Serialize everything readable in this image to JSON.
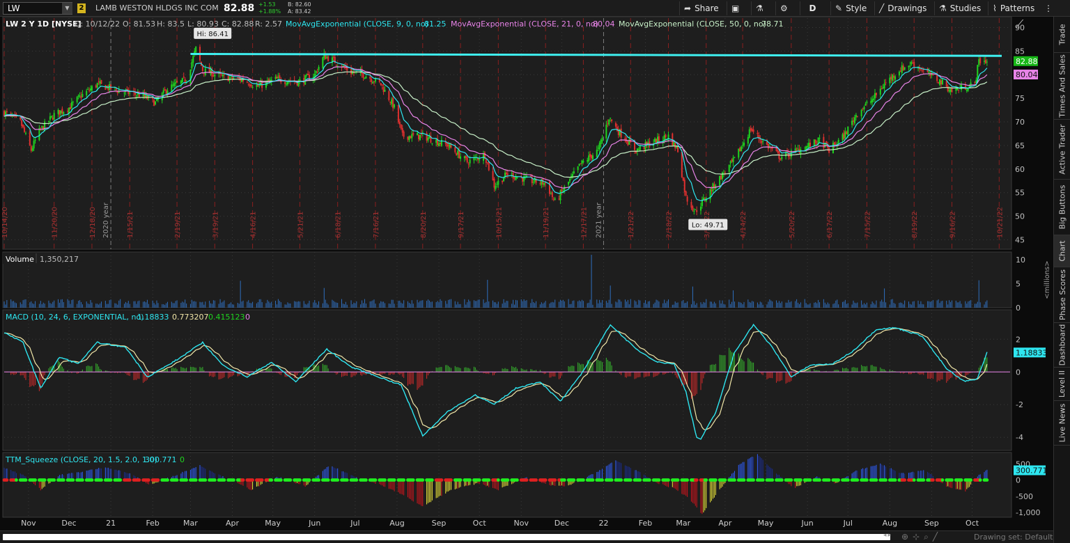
{
  "toolbar": {
    "symbol": "LW",
    "link_badge": "2",
    "company": "LAMB WESTON HLDGS INC COM",
    "last": "82.88",
    "change": "+1.53",
    "change_pct": "+1.88%",
    "bid": "B: 82.60",
    "ask": "A: 83.42",
    "share_label": "Share",
    "aggregation": "D",
    "style_label": "Style",
    "drawings_label": "Drawings",
    "studies_label": "Studies",
    "patterns_label": "Patterns"
  },
  "header": {
    "title": "LW 2 Y 1D [NYSE]",
    "date": "D: 10/12/22",
    "open": "O: 81.53",
    "high": "H: 83.5",
    "low": "L: 80.93",
    "close": "C: 82.88",
    "range": "R: 2.57",
    "ema9_label": "MovAvgExponential (CLOSE, 9, 0, no)",
    "ema9_value": "81.25",
    "ema21_label": "MovAvgExponential (CLOSE, 21, 0, no)",
    "ema21_value": "80.04",
    "ema50_label": "MovAvgExponential (CLOSE, 50, 0, no)",
    "ema50_value": "78.71"
  },
  "sidebar": {
    "tabs": [
      "Trade",
      "Times And Sales",
      "Active Trader",
      "Big Buttons",
      "Chart",
      "Phase Scores",
      "Dashboard",
      "Level II",
      "Live News"
    ],
    "active": "Chart"
  },
  "statusbar": {
    "drawing_set": "Drawing set: Default"
  },
  "colors": {
    "up": "#1fd51f",
    "down": "#e0302f",
    "ema9": "#2ee6f0",
    "ema21": "#e884e8",
    "ema50": "#c8f0c8",
    "resistance": "#3ff0f0",
    "background": "#1e1e1e"
  },
  "chart_data": [
    {
      "type": "candlestick",
      "panel": "price",
      "ylim": [
        43,
        92
      ],
      "yticks": [
        45,
        50,
        55,
        60,
        65,
        70,
        75,
        80,
        85,
        90
      ],
      "x_range": [
        "2020-10-14",
        "2022-10-26"
      ],
      "month_labels": [
        {
          "date": "2020-11-01",
          "label": "Nov"
        },
        {
          "date": "2020-12-01",
          "label": "Dec"
        },
        {
          "date": "2021-01-01",
          "label": "21"
        },
        {
          "date": "2021-02-01",
          "label": "Feb"
        },
        {
          "date": "2021-03-01",
          "label": "Mar"
        },
        {
          "date": "2021-04-01",
          "label": "Apr"
        },
        {
          "date": "2021-05-01",
          "label": "May"
        },
        {
          "date": "2021-06-01",
          "label": "Jun"
        },
        {
          "date": "2021-07-01",
          "label": "Jul"
        },
        {
          "date": "2021-08-01",
          "label": "Aug"
        },
        {
          "date": "2021-09-01",
          "label": "Sep"
        },
        {
          "date": "2021-10-01",
          "label": "Oct"
        },
        {
          "date": "2021-11-01",
          "label": "Nov"
        },
        {
          "date": "2021-12-01",
          "label": "Dec"
        },
        {
          "date": "2022-01-01",
          "label": "22"
        },
        {
          "date": "2022-02-01",
          "label": "Feb"
        },
        {
          "date": "2022-03-01",
          "label": "Mar"
        },
        {
          "date": "2022-04-01",
          "label": "Apr"
        },
        {
          "date": "2022-05-01",
          "label": "May"
        },
        {
          "date": "2022-06-01",
          "label": "Jun"
        },
        {
          "date": "2022-07-01",
          "label": "Jul"
        },
        {
          "date": "2022-08-01",
          "label": "Aug"
        },
        {
          "date": "2022-09-01",
          "label": "Sep"
        },
        {
          "date": "2022-10-01",
          "label": "Oct"
        }
      ],
      "event_markers": [
        {
          "date": "2020-10-14",
          "label": "10/14/20"
        },
        {
          "date": "2020-11-20",
          "label": "11/20/20"
        },
        {
          "date": "2020-12-18",
          "label": "12/18/20"
        },
        {
          "date": "2021-01-15",
          "label": "1/15/21"
        },
        {
          "date": "2021-02-19",
          "label": "2/19/21"
        },
        {
          "date": "2021-03-19",
          "label": "3/19/21"
        },
        {
          "date": "2021-04-16",
          "label": "4/16/21"
        },
        {
          "date": "2021-05-21",
          "label": "5/21/21"
        },
        {
          "date": "2021-06-18",
          "label": "6/18/21"
        },
        {
          "date": "2021-07-16",
          "label": "7/16/21"
        },
        {
          "date": "2021-08-20",
          "label": "8/20/21"
        },
        {
          "date": "2021-09-17",
          "label": "9/17/21"
        },
        {
          "date": "2021-10-15",
          "label": "10/15/21"
        },
        {
          "date": "2021-11-19",
          "label": "11/19/21"
        },
        {
          "date": "2021-12-17",
          "label": "12/17/21"
        },
        {
          "date": "2022-01-21",
          "label": "1/21/22"
        },
        {
          "date": "2022-02-18",
          "label": "2/18/22"
        },
        {
          "date": "2022-03-18",
          "label": "3/18/22"
        },
        {
          "date": "2022-04-14",
          "label": "4/14/22"
        },
        {
          "date": "2022-05-20",
          "label": "5/20/22"
        },
        {
          "date": "2022-06-17",
          "label": "6/17/22"
        },
        {
          "date": "2022-07-15",
          "label": "7/15/22"
        },
        {
          "date": "2022-08-19",
          "label": "8/19/22"
        },
        {
          "date": "2022-09-16",
          "label": "9/16/22"
        },
        {
          "date": "2022-10-21",
          "label": "10/21/22"
        }
      ],
      "year_markers": [
        {
          "date": "2021-01-01",
          "label": "2020 year"
        },
        {
          "date": "2022-01-01",
          "label": "2021 year"
        }
      ],
      "price_path": [
        [
          "2020-10-14",
          72
        ],
        [
          "2020-10-26",
          70
        ],
        [
          "2020-11-03",
          64
        ],
        [
          "2020-11-09",
          68
        ],
        [
          "2020-11-20",
          71.5
        ],
        [
          "2020-12-01",
          73
        ],
        [
          "2020-12-10",
          75.5
        ],
        [
          "2020-12-22",
          78
        ],
        [
          "2021-01-08",
          76.5
        ],
        [
          "2021-01-25",
          75.5
        ],
        [
          "2021-02-03",
          74
        ],
        [
          "2021-02-12",
          77
        ],
        [
          "2021-02-26",
          79
        ],
        [
          "2021-03-05",
          85.5
        ],
        [
          "2021-03-10",
          81
        ],
        [
          "2021-03-25",
          79.5
        ],
        [
          "2021-04-08",
          79
        ],
        [
          "2021-04-20",
          77.5
        ],
        [
          "2021-05-03",
          79
        ],
        [
          "2021-05-20",
          78.5
        ],
        [
          "2021-06-01",
          80
        ],
        [
          "2021-06-08",
          84
        ],
        [
          "2021-06-15",
          83
        ],
        [
          "2021-06-28",
          80.5
        ],
        [
          "2021-07-08",
          80
        ],
        [
          "2021-07-20",
          78
        ],
        [
          "2021-07-30",
          73
        ],
        [
          "2021-08-05",
          67
        ],
        [
          "2021-08-20",
          67
        ],
        [
          "2021-09-08",
          65
        ],
        [
          "2021-09-22",
          61.5
        ],
        [
          "2021-10-05",
          63
        ],
        [
          "2021-10-12",
          56.5
        ],
        [
          "2021-10-22",
          59
        ],
        [
          "2021-11-08",
          57.5
        ],
        [
          "2021-11-19",
          57
        ],
        [
          "2021-11-26",
          53
        ],
        [
          "2021-12-02",
          55.5
        ],
        [
          "2021-12-15",
          61
        ],
        [
          "2021-12-28",
          64
        ],
        [
          "2022-01-05",
          71
        ],
        [
          "2022-01-12",
          68
        ],
        [
          "2022-01-25",
          64
        ],
        [
          "2022-02-05",
          65.5
        ],
        [
          "2022-02-18",
          67
        ],
        [
          "2022-02-25",
          64
        ],
        [
          "2022-03-03",
          54
        ],
        [
          "2022-03-10",
          51
        ],
        [
          "2022-03-15",
          53
        ],
        [
          "2022-03-25",
          57
        ],
        [
          "2022-04-08",
          62
        ],
        [
          "2022-04-20",
          68.5
        ],
        [
          "2022-04-28",
          66
        ],
        [
          "2022-05-12",
          62.5
        ],
        [
          "2022-05-25",
          64
        ],
        [
          "2022-06-10",
          66
        ],
        [
          "2022-06-17",
          64
        ],
        [
          "2022-06-28",
          67
        ],
        [
          "2022-07-08",
          72
        ],
        [
          "2022-07-20",
          75
        ],
        [
          "2022-07-28",
          78
        ],
        [
          "2022-08-08",
          81
        ],
        [
          "2022-08-18",
          82.5
        ],
        [
          "2022-08-30",
          80
        ],
        [
          "2022-09-08",
          78.5
        ],
        [
          "2022-09-16",
          76.5
        ],
        [
          "2022-09-26",
          77.5
        ],
        [
          "2022-10-03",
          78
        ],
        [
          "2022-10-06",
          83
        ],
        [
          "2022-10-12",
          82.88
        ]
      ],
      "high": {
        "label": "Hi: 86.41",
        "value": 86.41,
        "date": "2021-03-05"
      },
      "low": {
        "label": "Lo: 49.71",
        "value": 49.71,
        "date": "2022-03-10"
      },
      "resistance_line": {
        "from": "2021-03-01",
        "to": "2022-10-26",
        "value_start": 84.4,
        "value_end": 84.0
      },
      "last_labels": {
        "price": "82.88",
        "ema21": "80.04"
      },
      "series": [
        {
          "name": "MovAvgExponential (CLOSE, 9, 0, no)",
          "value": 81.25
        },
        {
          "name": "MovAvgExponential (CLOSE, 21, 0, no)",
          "value": 80.04
        },
        {
          "name": "MovAvgExponential (CLOSE, 50, 0, no)",
          "value": 78.71
        }
      ]
    },
    {
      "type": "bar",
      "panel": "volume",
      "title": "Volume",
      "value_label": "1,350,217",
      "ylabel": "<millions>",
      "ylim": [
        0,
        11
      ],
      "yticks": [
        0,
        5,
        10
      ],
      "spikes": [
        [
          "2021-04-07",
          5.6
        ],
        [
          "2021-06-08",
          4.1
        ],
        [
          "2021-10-07",
          5.8
        ],
        [
          "2021-12-23",
          11.0
        ],
        [
          "2022-01-06",
          4.6
        ],
        [
          "2022-03-08",
          4.4
        ],
        [
          "2022-04-07",
          3.6
        ],
        [
          "2022-07-28",
          4.0
        ],
        [
          "2022-10-06",
          5.7
        ]
      ]
    },
    {
      "type": "line",
      "panel": "macd",
      "title": "MACD (10, 24, 6, EXPONENTIAL, no)",
      "values_shown": [
        "1.18833",
        "0.773207",
        "0.415123",
        "0"
      ],
      "ylim": [
        -4.8,
        3.8
      ],
      "yticks": [
        -4,
        -2,
        0,
        2
      ],
      "last_label": "1.18833",
      "path": [
        [
          "2020-10-14",
          2.4
        ],
        [
          "2020-10-28",
          1.8
        ],
        [
          "2020-11-10",
          -1.0
        ],
        [
          "2020-11-24",
          0.9
        ],
        [
          "2020-12-08",
          0.5
        ],
        [
          "2020-12-22",
          1.8
        ],
        [
          "2021-01-12",
          1.5
        ],
        [
          "2021-01-28",
          -0.3
        ],
        [
          "2021-02-10",
          0.3
        ],
        [
          "2021-02-22",
          0.9
        ],
        [
          "2021-03-10",
          1.8
        ],
        [
          "2021-03-25",
          0.4
        ],
        [
          "2021-04-12",
          -0.3
        ],
        [
          "2021-04-30",
          0.6
        ],
        [
          "2021-05-18",
          -0.6
        ],
        [
          "2021-06-10",
          1.4
        ],
        [
          "2021-06-28",
          0.3
        ],
        [
          "2021-07-15",
          -0.2
        ],
        [
          "2021-08-04",
          -0.8
        ],
        [
          "2021-08-20",
          -3.9
        ],
        [
          "2021-09-08",
          -2.4
        ],
        [
          "2021-09-28",
          -1.4
        ],
        [
          "2021-10-12",
          -2.0
        ],
        [
          "2021-10-28",
          -1.0
        ],
        [
          "2021-11-15",
          -0.6
        ],
        [
          "2021-11-30",
          -1.8
        ],
        [
          "2021-12-15",
          -0.2
        ],
        [
          "2022-01-06",
          2.9
        ],
        [
          "2022-01-25",
          1.4
        ],
        [
          "2022-02-10",
          0.6
        ],
        [
          "2022-02-22",
          0.5
        ],
        [
          "2022-03-03",
          -1.2
        ],
        [
          "2022-03-12",
          -4.4
        ],
        [
          "2022-03-25",
          -2.5
        ],
        [
          "2022-04-08",
          1.2
        ],
        [
          "2022-04-22",
          2.9
        ],
        [
          "2022-05-06",
          1.5
        ],
        [
          "2022-05-20",
          -0.3
        ],
        [
          "2022-06-03",
          0.4
        ],
        [
          "2022-06-20",
          0.5
        ],
        [
          "2022-07-05",
          1.3
        ],
        [
          "2022-07-22",
          2.6
        ],
        [
          "2022-08-05",
          2.7
        ],
        [
          "2022-08-25",
          2.2
        ],
        [
          "2022-09-12",
          0.2
        ],
        [
          "2022-09-25",
          -0.6
        ],
        [
          "2022-10-05",
          -0.4
        ],
        [
          "2022-10-12",
          1.19
        ]
      ]
    },
    {
      "type": "bar",
      "panel": "ttm_squeeze",
      "title": "TTM_Squeeze (CLOSE, 20, 1.5, 2.0, 1.0)",
      "values_shown": [
        "300.771",
        "0"
      ],
      "ylim": [
        -1150,
        850
      ],
      "yticks": [
        500,
        0,
        -500,
        -1000
      ],
      "ytick_labels": [
        "500",
        "0",
        "-500",
        "-1,000"
      ],
      "last_label": "300.771",
      "path": [
        [
          "2020-10-14",
          380
        ],
        [
          "2020-10-30",
          120
        ],
        [
          "2020-11-10",
          -300
        ],
        [
          "2020-11-24",
          150
        ],
        [
          "2020-12-10",
          250
        ],
        [
          "2020-12-28",
          400
        ],
        [
          "2021-01-15",
          200
        ],
        [
          "2021-01-30",
          -150
        ],
        [
          "2021-02-15",
          100
        ],
        [
          "2021-03-08",
          450
        ],
        [
          "2021-03-25",
          100
        ],
        [
          "2021-04-15",
          -300
        ],
        [
          "2021-05-05",
          100
        ],
        [
          "2021-05-25",
          -200
        ],
        [
          "2021-06-12",
          450
        ],
        [
          "2021-07-01",
          100
        ],
        [
          "2021-07-20",
          -150
        ],
        [
          "2021-08-05",
          -450
        ],
        [
          "2021-08-20",
          -820
        ],
        [
          "2021-09-10",
          -300
        ],
        [
          "2021-09-30",
          -100
        ],
        [
          "2021-10-15",
          -300
        ],
        [
          "2021-11-05",
          100
        ],
        [
          "2021-11-20",
          -150
        ],
        [
          "2021-12-05",
          -200
        ],
        [
          "2021-12-25",
          200
        ],
        [
          "2022-01-10",
          600
        ],
        [
          "2022-01-25",
          300
        ],
        [
          "2022-02-10",
          -100
        ],
        [
          "2022-02-22",
          -250
        ],
        [
          "2022-03-05",
          -550
        ],
        [
          "2022-03-15",
          -1050
        ],
        [
          "2022-03-28",
          -300
        ],
        [
          "2022-04-12",
          500
        ],
        [
          "2022-04-25",
          800
        ],
        [
          "2022-05-08",
          250
        ],
        [
          "2022-05-22",
          -250
        ],
        [
          "2022-06-08",
          100
        ],
        [
          "2022-06-22",
          -100
        ],
        [
          "2022-07-08",
          300
        ],
        [
          "2022-07-25",
          500
        ],
        [
          "2022-08-10",
          200
        ],
        [
          "2022-08-28",
          300
        ],
        [
          "2022-09-12",
          -200
        ],
        [
          "2022-09-26",
          -350
        ],
        [
          "2022-10-06",
          150
        ],
        [
          "2022-10-12",
          300.77
        ]
      ],
      "squeeze_on_ranges": [
        [
          "2020-10-14",
          "2020-10-22"
        ],
        [
          "2021-01-10",
          "2021-02-05"
        ],
        [
          "2021-04-08",
          "2021-04-28"
        ],
        [
          "2021-08-28",
          "2021-09-10"
        ],
        [
          "2021-10-10",
          "2021-10-14"
        ],
        [
          "2021-11-01",
          "2021-11-30"
        ],
        [
          "2022-03-10",
          "2022-03-16"
        ],
        [
          "2022-08-10",
          "2022-08-18"
        ],
        [
          "2022-09-01",
          "2022-09-08"
        ],
        [
          "2022-10-02",
          "2022-10-06"
        ]
      ]
    }
  ]
}
